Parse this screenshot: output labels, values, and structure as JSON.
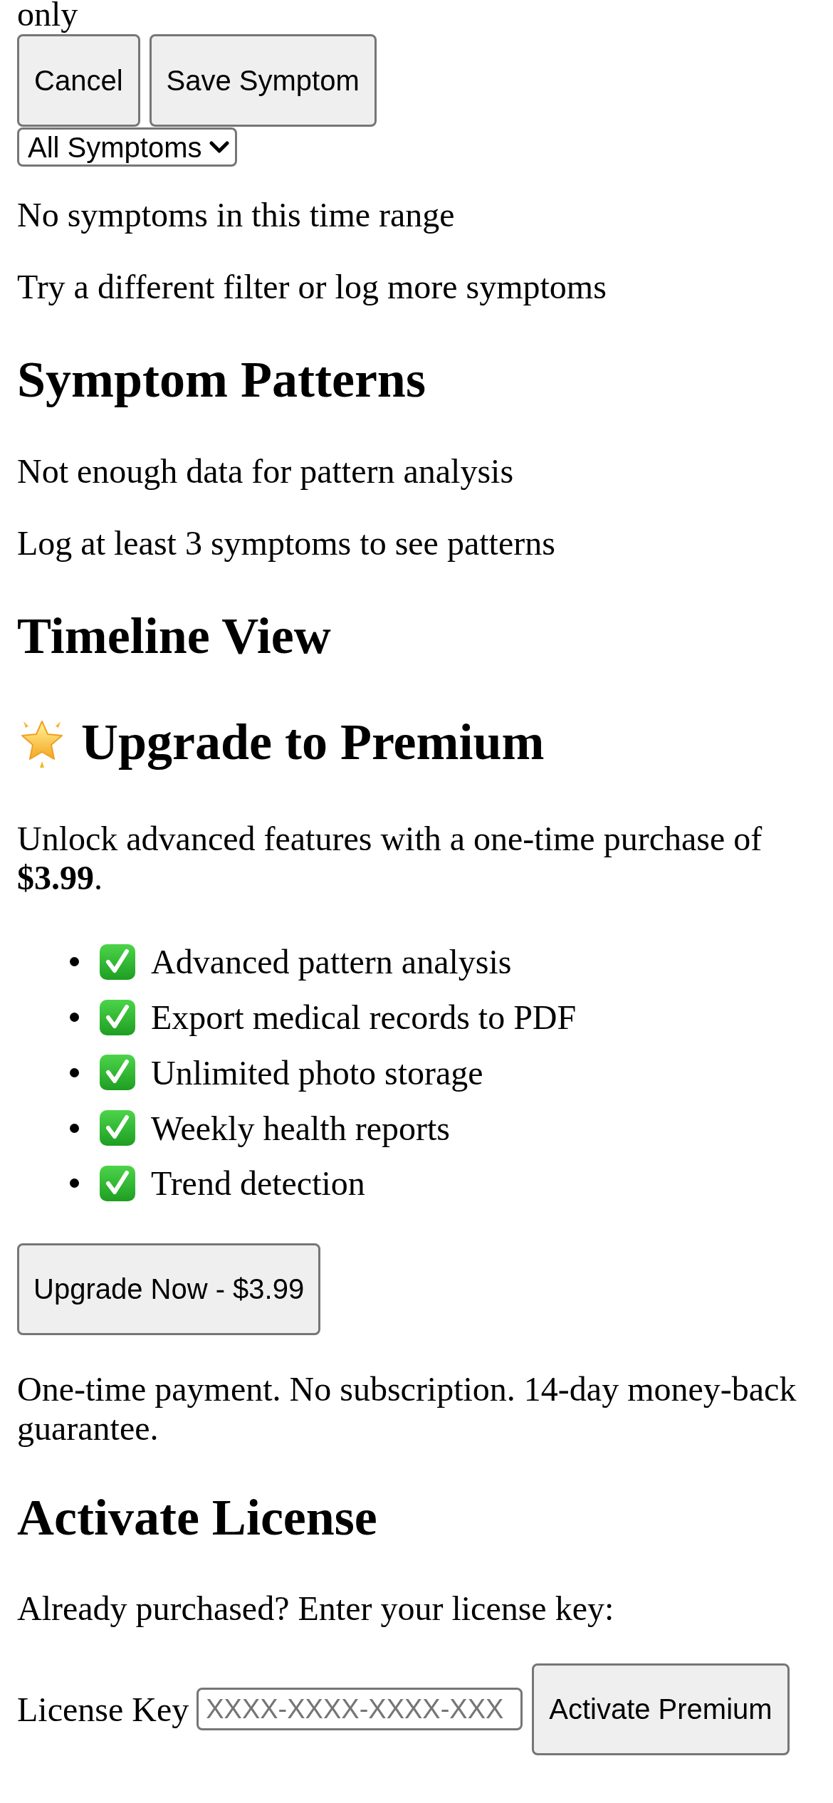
{
  "cut_off_text": "only",
  "form_buttons": [
    {
      "label": "Cancel"
    },
    {
      "label": "Save Symptom"
    }
  ],
  "filter": {
    "value": "All Symptoms"
  },
  "empty_state": {
    "title": "No symptoms in this time range",
    "hint": "Try a different filter or log more symptoms"
  },
  "patterns": {
    "heading": "Symptom Patterns",
    "message": "Not enough data for pattern analysis",
    "hint": "Log at least 3 symptoms to see patterns"
  },
  "timeline": {
    "heading": "Timeline View"
  },
  "premium": {
    "heading": "Upgrade to Premium",
    "description": "Unlock advanced features with a one-time purchase of **$3.99**.",
    "features": [
      "Advanced pattern analysis",
      "Export medical records to PDF",
      "Unlimited photo storage",
      "Weekly health reports",
      "Trend detection"
    ],
    "button": "Upgrade Now - $3.99",
    "note": "One-time payment. No subscription. 14-day money-back guarantee."
  },
  "license": {
    "heading": "Activate License",
    "prompt": "Already purchased? Enter your license key:",
    "field_label": "License Key",
    "placeholder": "XXXX-XXXX-XXXX-XXX",
    "button": "Activate Premium"
  }
}
